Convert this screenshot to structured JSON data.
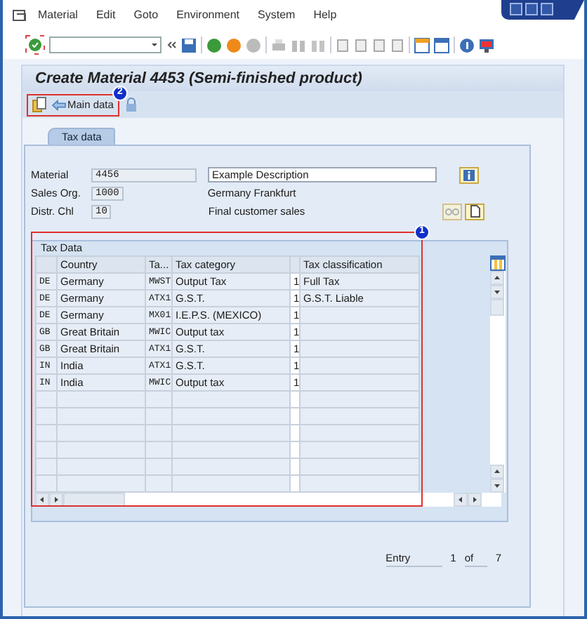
{
  "menu": [
    {
      "label": "Material"
    },
    {
      "label": "Edit"
    },
    {
      "label": "Goto"
    },
    {
      "label": "Environment"
    },
    {
      "label": "System"
    },
    {
      "label": "Help"
    }
  ],
  "title": "Create Material 4453 (Semi-finished product)",
  "app_toolbar": {
    "button": "Main data",
    "callout": "2",
    "highlighted": true
  },
  "tabs": [
    {
      "label": "Tax data",
      "selected": true
    }
  ],
  "fields": [
    {
      "label": "Material",
      "value": "4456",
      "text": "Example Description",
      "kind": "input"
    },
    {
      "label": "Sales Org.",
      "value": "1000",
      "text": "Germany Frankfurt",
      "kind": "plain"
    },
    {
      "label": "Distr. Chl",
      "value": "10",
      "text": "Final customer sales",
      "kind": "plain"
    }
  ],
  "tax_table": {
    "title": "Tax Data",
    "callout": "1",
    "highlighted": true,
    "columns": [
      {
        "kind": "code"
      },
      {
        "kind": "text",
        "label": "Country"
      },
      {
        "kind": "code",
        "label": "Ta..."
      },
      {
        "kind": "text",
        "label": "Tax category"
      },
      {
        "kind": "marker"
      },
      {
        "kind": "text",
        "label": "Tax classification"
      }
    ],
    "rows": [
      {
        "cells": [
          "DE",
          "Germany",
          "MWST",
          "Output Tax",
          "1",
          "Full Tax"
        ]
      },
      {
        "cells": [
          "DE",
          "Germany",
          "ATX1",
          "G.S.T.",
          "1",
          "G.S.T. Liable"
        ]
      },
      {
        "cells": [
          "DE",
          "Germany",
          "MX01",
          "I.E.P.S.  (MEXICO)",
          "1"
        ]
      },
      {
        "cells": [
          "GB",
          "Great Britain",
          "MWIC",
          "Output tax",
          "1"
        ]
      },
      {
        "cells": [
          "GB",
          "Great Britain",
          "ATX1",
          "G.S.T.",
          "1"
        ]
      },
      {
        "cells": [
          "IN",
          "India",
          "ATX1",
          "G.S.T.",
          "1"
        ]
      },
      {
        "cells": [
          "IN",
          "India",
          "MWIC",
          "Output tax",
          "1"
        ]
      }
    ]
  },
  "entry": {
    "label": "Entry",
    "current": "1",
    "of": "of",
    "total": "7"
  }
}
